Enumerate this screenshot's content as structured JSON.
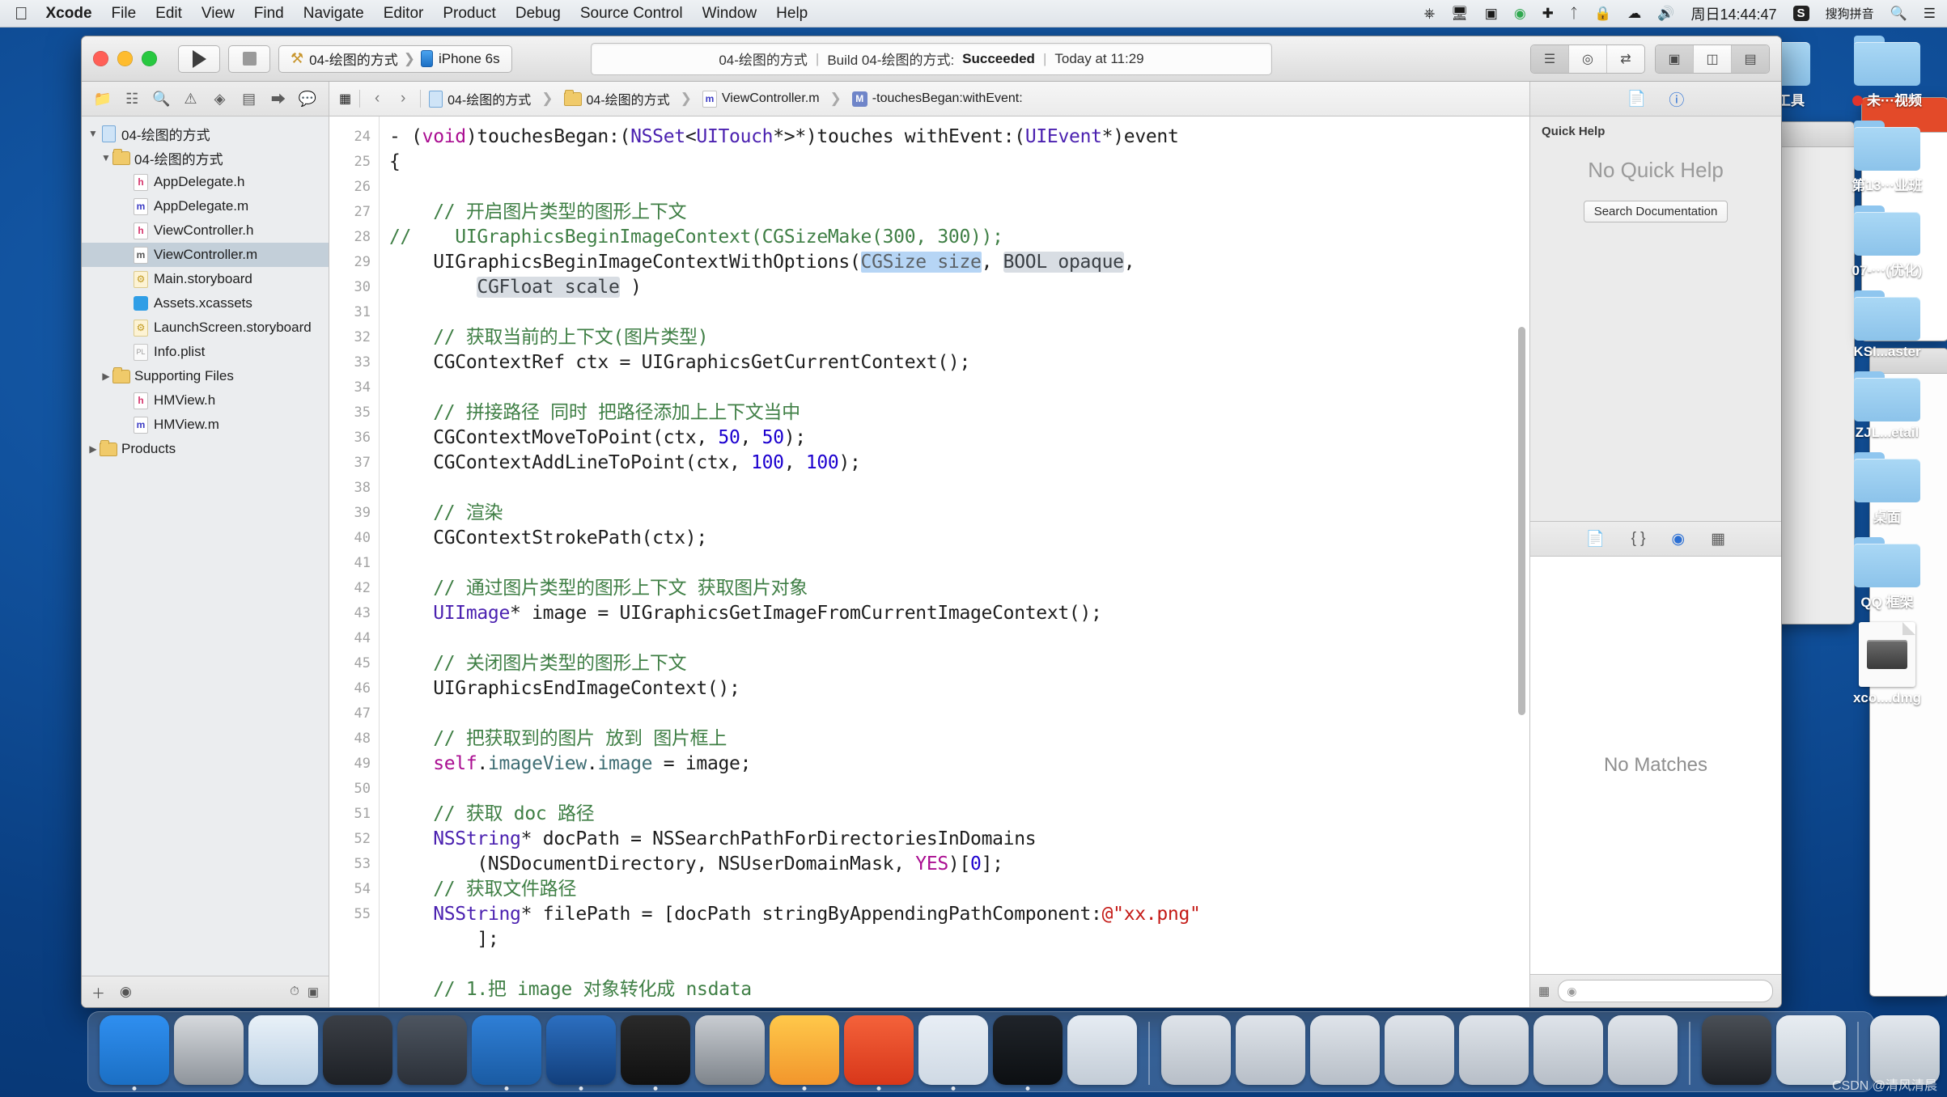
{
  "menubar": {
    "apple_icon": "apple-icon",
    "items": [
      {
        "label": "Xcode",
        "bold": true
      },
      {
        "label": "File",
        "bold": false
      },
      {
        "label": "Edit",
        "bold": false
      },
      {
        "label": "View",
        "bold": false
      },
      {
        "label": "Find",
        "bold": false
      },
      {
        "label": "Navigate",
        "bold": false
      },
      {
        "label": "Editor",
        "bold": false
      },
      {
        "label": "Product",
        "bold": false
      },
      {
        "label": "Debug",
        "bold": false
      },
      {
        "label": "Source Control",
        "bold": false
      },
      {
        "label": "Window",
        "bold": false
      },
      {
        "label": "Help",
        "bold": false
      }
    ],
    "status_icons": [
      "power-icon",
      "screen-share-icon",
      "screen-record-icon",
      "play-badge-icon",
      "airplane-icon",
      "bluetooth-icon",
      "lock-icon",
      "wifi-icon",
      "volume-icon"
    ],
    "clock": "周日14:44:47",
    "input_method_badge": "S",
    "input_method_label": "搜狗拼音",
    "search_icon": "search-icon",
    "control_center_icon": "list-icon"
  },
  "xcode": {
    "window_controls": {
      "close": "close-button",
      "minimize": "minimize-button",
      "zoom": "zoom-button"
    },
    "run_button": "run-button",
    "stop_button": "stop-button",
    "scheme": {
      "project": "04-绘图的方式",
      "separator": "❯",
      "destination": "iPhone 6s"
    },
    "status": {
      "project": "04-绘图的方式",
      "build_text": "Build 04-绘图的方式:",
      "result": "Succeeded",
      "time": "Today at 11:29",
      "separator": "|"
    },
    "editor_segment": [
      "standard-editor-icon",
      "assistant-editor-icon",
      "version-editor-icon"
    ],
    "panel_segment": [
      "toggle-navigator-icon",
      "toggle-debug-icon",
      "toggle-utilities-icon"
    ]
  },
  "navigator": {
    "tabs": [
      "project-navigator-icon",
      "source-control-navigator-icon",
      "find-navigator-icon",
      "issue-navigator-icon",
      "test-navigator-icon",
      "debug-navigator-icon",
      "breakpoint-navigator-icon",
      "report-navigator-icon"
    ],
    "tree": [
      {
        "label": "04-绘图的方式",
        "icon": "project-icon",
        "indent": 0,
        "twisty": "▼",
        "selected": false
      },
      {
        "label": "04-绘图的方式",
        "icon": "folder-icon",
        "indent": 1,
        "twisty": "▼",
        "selected": false
      },
      {
        "label": "AppDelegate.h",
        "icon": "header-file-icon",
        "indent": 2,
        "twisty": "",
        "selected": false
      },
      {
        "label": "AppDelegate.m",
        "icon": "implementation-file-icon",
        "indent": 2,
        "twisty": "",
        "selected": false
      },
      {
        "label": "ViewController.h",
        "icon": "header-file-icon",
        "indent": 2,
        "twisty": "",
        "selected": false
      },
      {
        "label": "ViewController.m",
        "icon": "implementation-file-icon",
        "indent": 2,
        "twisty": "",
        "selected": true
      },
      {
        "label": "Main.storyboard",
        "icon": "storyboard-icon",
        "indent": 2,
        "twisty": "",
        "selected": false
      },
      {
        "label": "Assets.xcassets",
        "icon": "assets-icon",
        "indent": 2,
        "twisty": "",
        "selected": false
      },
      {
        "label": "LaunchScreen.storyboard",
        "icon": "storyboard-icon",
        "indent": 2,
        "twisty": "",
        "selected": false
      },
      {
        "label": "Info.plist",
        "icon": "plist-icon",
        "indent": 2,
        "twisty": "",
        "selected": false
      },
      {
        "label": "Supporting Files",
        "icon": "folder-icon",
        "indent": 1,
        "twisty": "▶",
        "selected": false
      },
      {
        "label": "HMView.h",
        "icon": "header-file-icon",
        "indent": 2,
        "twisty": "",
        "selected": false
      },
      {
        "label": "HMView.m",
        "icon": "implementation-file-icon",
        "indent": 2,
        "twisty": "",
        "selected": false
      },
      {
        "label": "Products",
        "icon": "folder-icon",
        "indent": 0,
        "twisty": "▶",
        "selected": false
      }
    ],
    "footer": {
      "add_icon": "add-icon",
      "filter_icon": "filter-icon",
      "recent_icon": "recent-icon",
      "sourcecontrol_icon": "source-control-icon"
    }
  },
  "jumpbar": {
    "related_icon": "related-items-icon",
    "back_icon": "◀",
    "forward_icon": "▶",
    "crumbs": [
      {
        "label": "04-绘图的方式",
        "icon": "project-icon"
      },
      {
        "label": "04-绘图的方式",
        "icon": "folder-icon"
      },
      {
        "label": "ViewController.m",
        "icon": "implementation-file-icon"
      },
      {
        "label": "-touchesBegan:withEvent:",
        "icon": "method-icon"
      }
    ],
    "separator": "❯"
  },
  "code": {
    "first_line_number": 24,
    "lines": [
      {
        "n": 24,
        "tokens": [
          {
            "t": "- (",
            "c": ""
          },
          {
            "t": "void",
            "c": "kw"
          },
          {
            "t": ")touchesBegan:(",
            "c": ""
          },
          {
            "t": "NSSet",
            "c": "cls"
          },
          {
            "t": "<",
            "c": ""
          },
          {
            "t": "UITouch",
            "c": "cls"
          },
          {
            "t": "*>*)touches withEvent:(",
            "c": ""
          },
          {
            "t": "UIEvent",
            "c": "cls"
          },
          {
            "t": "*)event",
            "c": ""
          }
        ]
      },
      {
        "n": 25,
        "tokens": [
          {
            "t": "{",
            "c": ""
          }
        ]
      },
      {
        "n": 26,
        "tokens": []
      },
      {
        "n": 27,
        "tokens": [
          {
            "t": "    // 开启图片类型的图形上下文",
            "c": "cmt"
          }
        ]
      },
      {
        "n": 28,
        "tokens": [
          {
            "t": "//    UIGraphicsBeginImageContext(CGSizeMake(300, 300));",
            "c": "cmt"
          }
        ]
      },
      {
        "n": 29,
        "tokens": [
          {
            "t": "    UIGraphicsBeginImageContextWithOptions(",
            "c": ""
          },
          {
            "t": "CGSize size",
            "c": "sel-tok"
          },
          {
            "t": ", ",
            "c": ""
          },
          {
            "t": "BOOL opaque",
            "c": "ph"
          },
          {
            "t": ",",
            "c": ""
          }
        ]
      },
      {
        "n": null,
        "tokens": [
          {
            "t": "        ",
            "c": ""
          },
          {
            "t": "CGFloat scale",
            "c": "ph"
          },
          {
            "t": " )",
            "c": ""
          }
        ]
      },
      {
        "n": 30,
        "tokens": []
      },
      {
        "n": 31,
        "tokens": [
          {
            "t": "    // 获取当前的上下文(图片类型)",
            "c": "cmt"
          }
        ]
      },
      {
        "n": 32,
        "tokens": [
          {
            "t": "    CGContextRef ctx = UIGraphicsGetCurrentContext();",
            "c": ""
          }
        ]
      },
      {
        "n": 33,
        "tokens": []
      },
      {
        "n": 34,
        "tokens": [
          {
            "t": "    // 拼接路径 同时 把路径添加上上下文当中",
            "c": "cmt"
          }
        ]
      },
      {
        "n": 35,
        "tokens": [
          {
            "t": "    CGContextMoveToPoint(ctx, ",
            "c": ""
          },
          {
            "t": "50",
            "c": "num"
          },
          {
            "t": ", ",
            "c": ""
          },
          {
            "t": "50",
            "c": "num"
          },
          {
            "t": ");",
            "c": ""
          }
        ]
      },
      {
        "n": 36,
        "tokens": [
          {
            "t": "    CGContextAddLineToPoint(ctx, ",
            "c": ""
          },
          {
            "t": "100",
            "c": "num"
          },
          {
            "t": ", ",
            "c": ""
          },
          {
            "t": "100",
            "c": "num"
          },
          {
            "t": ");",
            "c": ""
          }
        ]
      },
      {
        "n": 37,
        "tokens": []
      },
      {
        "n": 38,
        "tokens": [
          {
            "t": "    // 渲染",
            "c": "cmt"
          }
        ]
      },
      {
        "n": 39,
        "tokens": [
          {
            "t": "    CGContextStrokePath(ctx);",
            "c": ""
          }
        ]
      },
      {
        "n": 40,
        "tokens": []
      },
      {
        "n": 41,
        "tokens": [
          {
            "t": "    // 通过图片类型的图形上下文 获取图片对象",
            "c": "cmt"
          }
        ]
      },
      {
        "n": 42,
        "tokens": [
          {
            "t": "    UIImage",
            "c": "cls"
          },
          {
            "t": "* image = UIGraphicsGetImageFromCurrentImageContext();",
            "c": ""
          }
        ]
      },
      {
        "n": 43,
        "tokens": []
      },
      {
        "n": 44,
        "tokens": [
          {
            "t": "    // 关闭图片类型的图形上下文",
            "c": "cmt"
          }
        ]
      },
      {
        "n": 45,
        "tokens": [
          {
            "t": "    UIGraphicsEndImageContext();",
            "c": ""
          }
        ]
      },
      {
        "n": 46,
        "tokens": []
      },
      {
        "n": 47,
        "tokens": [
          {
            "t": "    // 把获取到的图片 放到 图片框上",
            "c": "cmt"
          }
        ]
      },
      {
        "n": 48,
        "tokens": [
          {
            "t": "    ",
            "c": ""
          },
          {
            "t": "self",
            "c": "kw"
          },
          {
            "t": ".",
            "c": ""
          },
          {
            "t": "imageView",
            "c": "prop"
          },
          {
            "t": ".",
            "c": ""
          },
          {
            "t": "image",
            "c": "prop"
          },
          {
            "t": " = image;",
            "c": ""
          }
        ]
      },
      {
        "n": 49,
        "tokens": []
      },
      {
        "n": 50,
        "tokens": [
          {
            "t": "    // 获取 doc 路径",
            "c": "cmt"
          }
        ]
      },
      {
        "n": 51,
        "tokens": [
          {
            "t": "    ",
            "c": ""
          },
          {
            "t": "NSString",
            "c": "cls"
          },
          {
            "t": "* docPath = NSSearchPathForDirectoriesInDomains",
            "c": ""
          }
        ]
      },
      {
        "n": null,
        "tokens": [
          {
            "t": "        (NSDocumentDirectory, NSUserDomainMask, ",
            "c": ""
          },
          {
            "t": "YES",
            "c": "kw"
          },
          {
            "t": ")[",
            "c": ""
          },
          {
            "t": "0",
            "c": "num"
          },
          {
            "t": "];",
            "c": ""
          }
        ]
      },
      {
        "n": 52,
        "tokens": [
          {
            "t": "    // 获取文件路径",
            "c": "cmt"
          }
        ]
      },
      {
        "n": 53,
        "tokens": [
          {
            "t": "    ",
            "c": ""
          },
          {
            "t": "NSString",
            "c": "cls"
          },
          {
            "t": "* filePath = [docPath stringByAppendingPathComponent:",
            "c": ""
          },
          {
            "t": "@\"xx.png\"",
            "c": "str"
          }
        ]
      },
      {
        "n": null,
        "tokens": [
          {
            "t": "        ];",
            "c": ""
          }
        ]
      },
      {
        "n": 54,
        "tokens": []
      },
      {
        "n": 55,
        "tokens": [
          {
            "t": "    // 1.把 image 对象转化成 nsdata",
            "c": "cmt"
          }
        ]
      }
    ]
  },
  "utilities": {
    "inspector_tabs": [
      "file-inspector-icon",
      "quick-help-icon"
    ],
    "quick_help_title": "Quick Help",
    "quick_help_message": "No Quick Help",
    "search_documentation_label": "Search Documentation",
    "library_tabs": [
      "file-template-library-icon",
      "code-snippet-library-icon",
      "object-library-icon",
      "media-library-icon"
    ],
    "library_message": "No Matches",
    "library_filter_placeholder": ""
  },
  "desktop": {
    "icons_col_right": [
      {
        "label": "未···视频",
        "type": "folder",
        "dot": true
      },
      {
        "label": "第13···业班",
        "type": "folder",
        "dot": false
      },
      {
        "label": "07-···(优化)",
        "type": "folder",
        "dot": false
      },
      {
        "label": "KSI...aster",
        "type": "folder",
        "dot": false
      },
      {
        "label": "ZJL...etail",
        "type": "folder",
        "dot": false
      },
      {
        "label": "桌面",
        "type": "folder",
        "dot": false
      },
      {
        "label": "QQ 框架",
        "type": "folder",
        "dot": false
      },
      {
        "label": "xco....dmg",
        "type": "dmg",
        "dot": false
      }
    ],
    "icons_col_left": [
      {
        "label": "开发工具",
        "type": "folder",
        "dot": false
      }
    ]
  },
  "dock": {
    "apps": [
      {
        "name": "finder-icon",
        "color": "linear-gradient(#2f8ff0,#1b6fc4)",
        "running": true
      },
      {
        "name": "launchpad-icon",
        "color": "linear-gradient(#d6d9dd,#8e949b)",
        "running": false
      },
      {
        "name": "safari-icon",
        "color": "linear-gradient(#e9f1f8,#b9cfe3)",
        "running": false
      },
      {
        "name": "mouse-app-icon",
        "color": "linear-gradient(#3b3f46,#1d2025)",
        "running": false
      },
      {
        "name": "imovie-icon",
        "color": "linear-gradient(#4d5560,#2b3038)",
        "running": false
      },
      {
        "name": "xcode-icon",
        "color": "linear-gradient(#2f7fd6,#1a5ba3)",
        "running": true
      },
      {
        "name": "xcode-beta-icon",
        "color": "linear-gradient(#2c6fc0,#123f7c)",
        "running": true
      },
      {
        "name": "terminal-icon",
        "color": "linear-gradient(#2a2a2a,#101010)",
        "running": true
      },
      {
        "name": "system-preferences-icon",
        "color": "linear-gradient(#c9cdd2,#7e848b)",
        "running": false
      },
      {
        "name": "sketch-icon",
        "color": "linear-gradient(#ffc84a,#f2962c)",
        "running": true
      },
      {
        "name": "paw-icon",
        "color": "linear-gradient(#f4623a,#d8371a)",
        "running": true
      },
      {
        "name": "sequel-pro-icon",
        "color": "linear-gradient(#e8eef5,#cfd9e4)",
        "running": true
      },
      {
        "name": "mweb-icon",
        "color": "linear-gradient(#20242a,#0c0f12)",
        "running": true
      },
      {
        "name": "chrome-icon",
        "color": "linear-gradient(#e6ecf3,#c3ccd6)",
        "running": false
      },
      {
        "name": "preview-window-icon",
        "color": "linear-gradient(#dfe4ea,#b7bec7)",
        "running": false
      },
      {
        "name": "preview-window-icon",
        "color": "linear-gradient(#dfe4ea,#b7bec7)",
        "running": false
      },
      {
        "name": "preview-window-icon",
        "color": "linear-gradient(#dfe4ea,#b7bec7)",
        "running": false
      },
      {
        "name": "preview-window-icon",
        "color": "linear-gradient(#dfe4ea,#b7bec7)",
        "running": false
      },
      {
        "name": "preview-window-icon",
        "color": "linear-gradient(#dfe4ea,#b7bec7)",
        "running": false
      },
      {
        "name": "preview-window-icon",
        "color": "linear-gradient(#dfe4ea,#b7bec7)",
        "running": false
      },
      {
        "name": "preview-window-icon",
        "color": "linear-gradient(#dfe4ea,#b7bec7)",
        "running": false
      },
      {
        "name": "calculator-icon",
        "color": "linear-gradient(#4a4f56,#1d2025)",
        "running": false
      },
      {
        "name": "downloads-stack-icon",
        "color": "linear-gradient(#e8edf2,#c6cfd8)",
        "running": false
      },
      {
        "name": "trash-icon",
        "color": "linear-gradient(#e3e8ee,#b9c2cb)",
        "running": false
      }
    ]
  },
  "watermark": "CSDN @清风清晨"
}
